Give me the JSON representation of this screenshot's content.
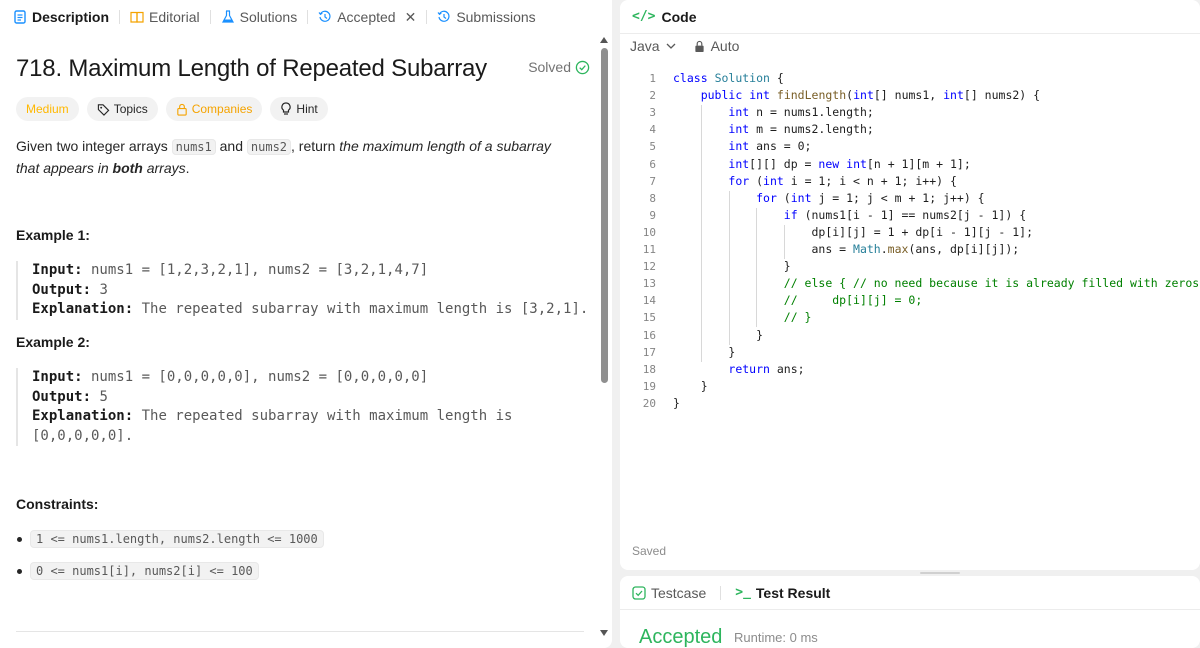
{
  "tabs": [
    {
      "label": "Description",
      "icon": "description-icon"
    },
    {
      "label": "Editorial",
      "icon": "book-icon"
    },
    {
      "label": "Solutions",
      "icon": "flask-icon"
    },
    {
      "label": "Accepted",
      "icon": "history-icon"
    },
    {
      "label": "Submissions",
      "icon": "history-icon"
    }
  ],
  "problem": {
    "title": "718. Maximum Length of Repeated Subarray",
    "solved_label": "Solved",
    "difficulty": "Medium",
    "topics_label": "Topics",
    "companies_label": "Companies",
    "hint_label": "Hint",
    "desc_1": "Given two integer arrays ",
    "desc_code_1": "nums1",
    "desc_2": " and ",
    "desc_code_2": "nums2",
    "desc_3": ", return ",
    "desc_em": "the maximum length of a subarray that appears in ",
    "desc_bold": "both",
    "desc_em_end": " arrays",
    "desc_end": "."
  },
  "examples": [
    {
      "heading": "Example 1:",
      "input_label": "Input:",
      "input": " nums1 = [1,2,3,2,1], nums2 = [3,2,1,4,7]",
      "output_label": "Output:",
      "output": " 3",
      "explanation_label": "Explanation:",
      "explanation": " The repeated subarray with maximum length is [3,2,1]."
    },
    {
      "heading": "Example 2:",
      "input_label": "Input:",
      "input": " nums1 = [0,0,0,0,0], nums2 = [0,0,0,0,0]",
      "output_label": "Output:",
      "output": " 5",
      "explanation_label": "Explanation:",
      "explanation": " The repeated subarray with maximum length is",
      "explanation_2": "[0,0,0,0,0]."
    }
  ],
  "constraints": {
    "heading": "Constraints:",
    "items": [
      "1 <= nums1.length, nums2.length <= 1000",
      "0 <= nums1[i], nums2[i] <= 100"
    ]
  },
  "code_panel": {
    "header": "Code",
    "language": "Java",
    "mode": "Auto",
    "saved_label": "Saved",
    "lines": [
      "class Solution {",
      "    public int findLength(int[] nums1, int[] nums2) {",
      "        int n = nums1.length;",
      "        int m = nums2.length;",
      "        int ans = 0;",
      "        int[][] dp = new int[n + 1][m + 1];",
      "        for (int i = 1; i < n + 1; i++) {",
      "            for (int j = 1; j < m + 1; j++) {",
      "                if (nums1[i - 1] == nums2[j - 1]) {",
      "                    dp[i][j] = 1 + dp[i - 1][j - 1];",
      "                    ans = Math.max(ans, dp[i][j]);",
      "                }",
      "                // else { // no need because it is already filled with zeros",
      "                //     dp[i][j] = 0;",
      "                // }",
      "            }",
      "        }",
      "        return ans;",
      "    }",
      "}"
    ]
  },
  "result_panel": {
    "testcase_label": "Testcase",
    "test_result_label": "Test Result",
    "status": "Accepted",
    "runtime": "Runtime: 0 ms"
  },
  "colors": {
    "accepted": "#2db55d",
    "medium": "#ffb800",
    "link": "#1a90ff"
  }
}
